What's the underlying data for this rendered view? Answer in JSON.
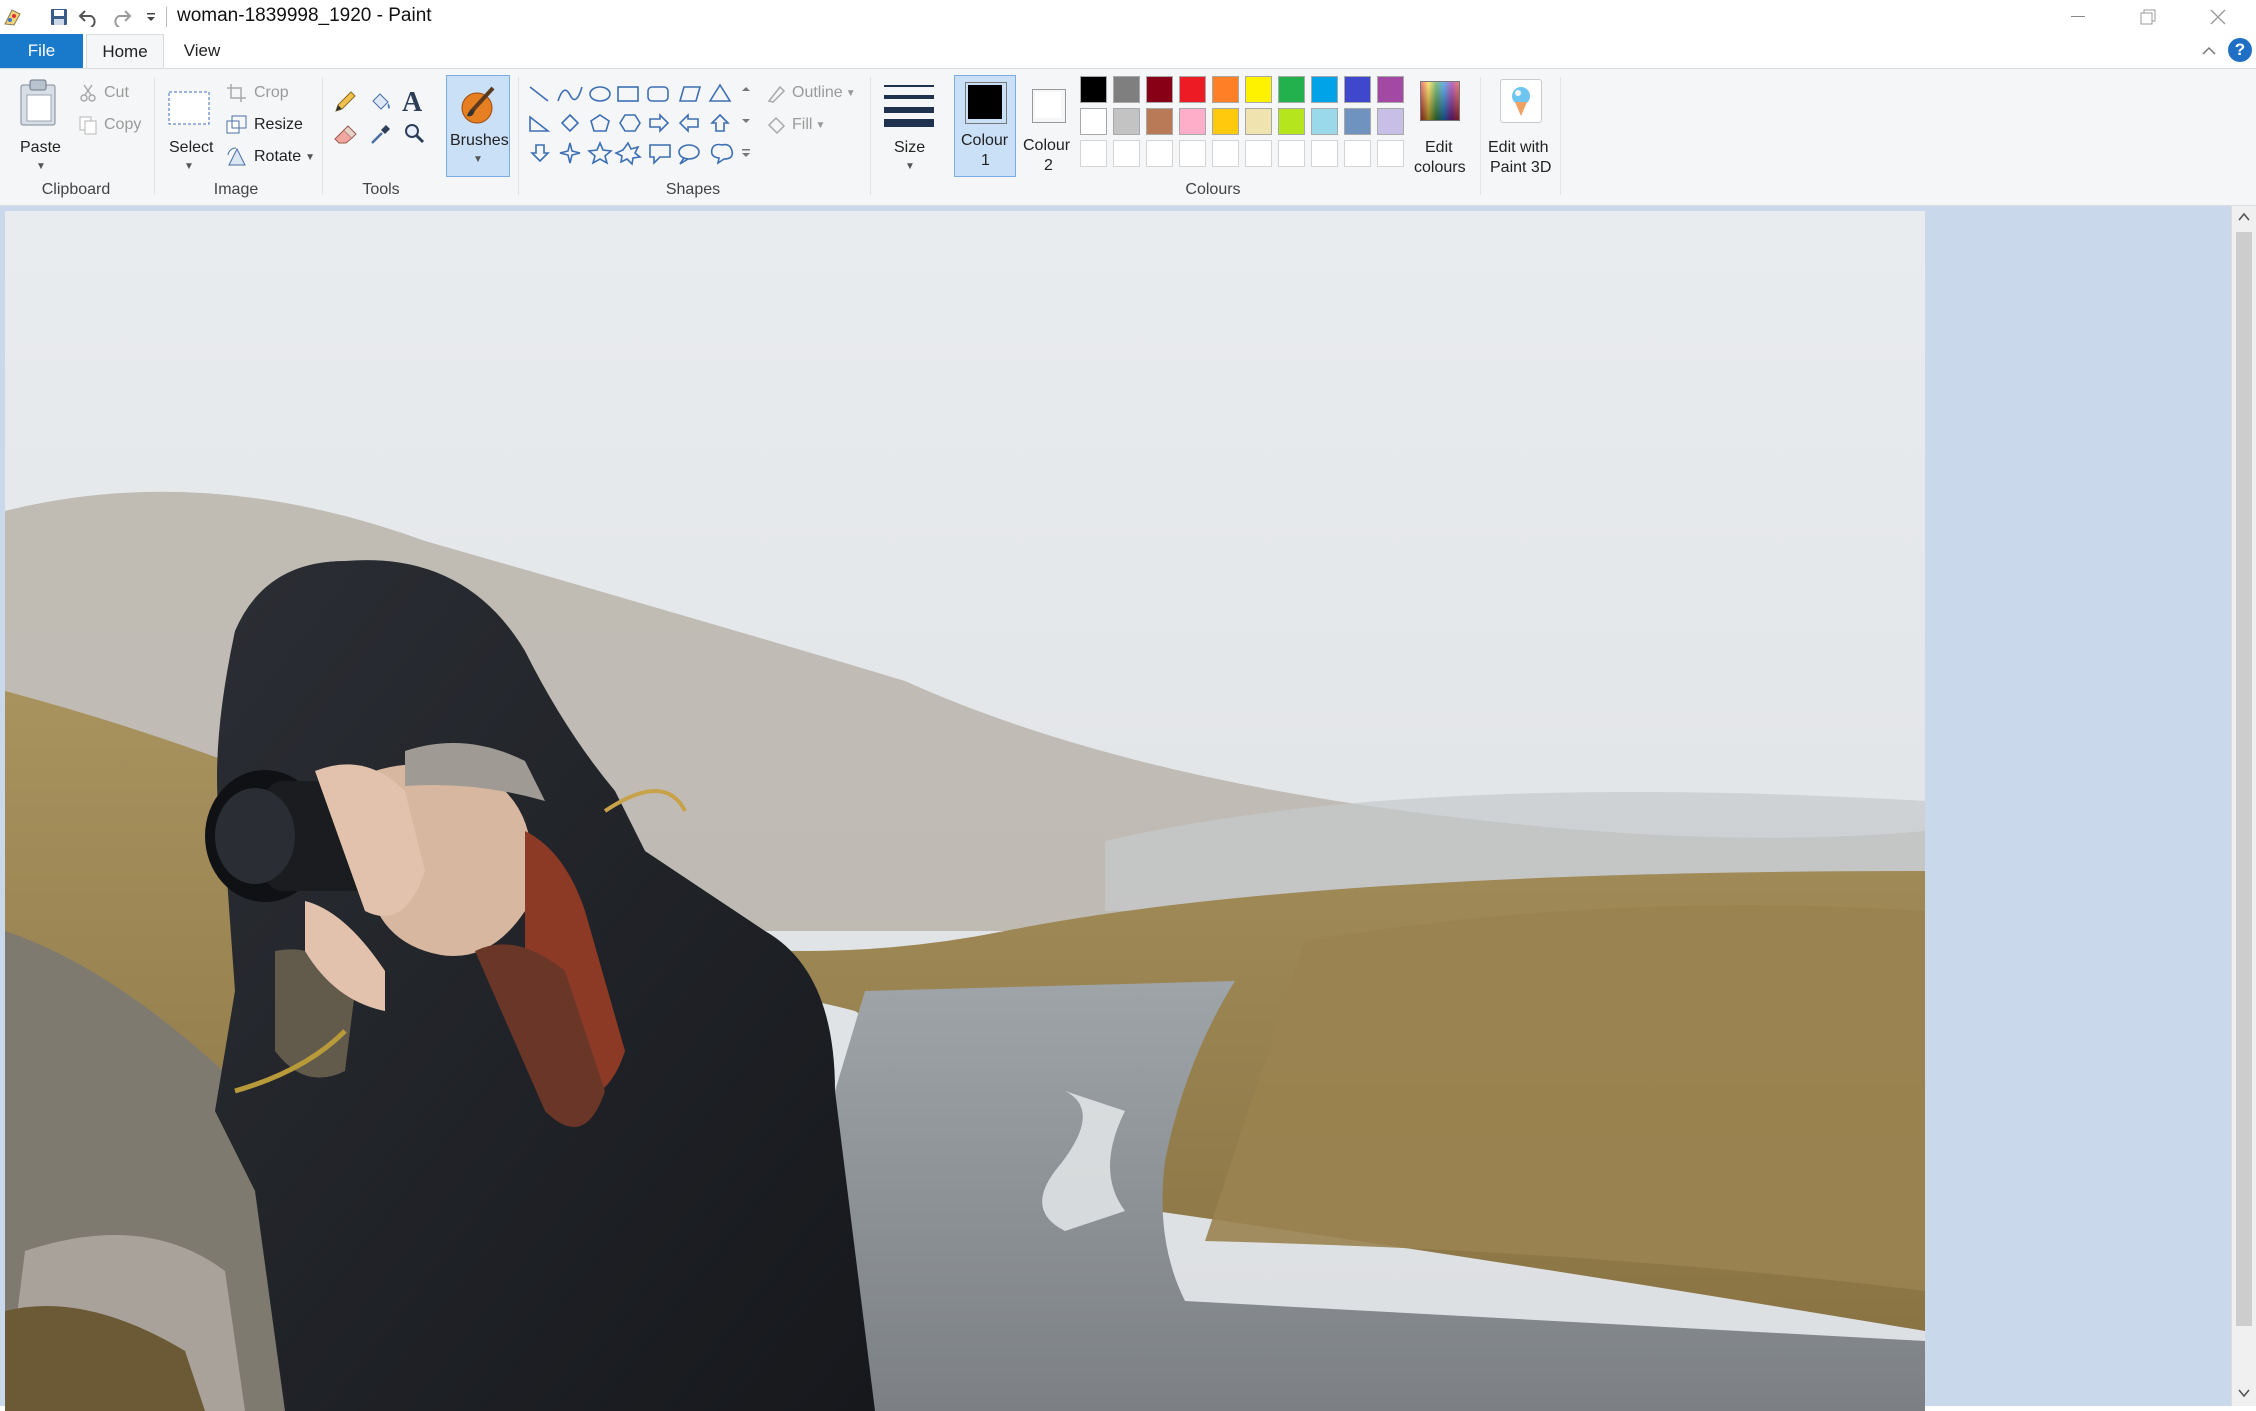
{
  "window": {
    "title": "woman-1839998_1920 - Paint"
  },
  "tabs": {
    "file": "File",
    "home": "Home",
    "view": "View"
  },
  "clipboard": {
    "paste": "Paste",
    "cut": "Cut",
    "copy": "Copy",
    "group": "Clipboard"
  },
  "image": {
    "select": "Select",
    "crop": "Crop",
    "resize": "Resize",
    "rotate": "Rotate",
    "group": "Image"
  },
  "tools": {
    "group": "Tools",
    "brushes": "Brushes"
  },
  "shapes": {
    "outline": "Outline",
    "fill": "Fill",
    "group": "Shapes"
  },
  "size": {
    "label": "Size"
  },
  "colours": {
    "colour1_line1": "Colour",
    "colour1_line2": "1",
    "colour2_line1": "Colour",
    "colour2_line2": "2",
    "edit_line1": "Edit",
    "edit_line2": "colours",
    "group": "Colours",
    "colour1_value": "#000000",
    "colour2_value": "#ffffff",
    "palette_row1": [
      "#000000",
      "#7f7f7f",
      "#880015",
      "#ed1c24",
      "#ff7f27",
      "#fff200",
      "#22b14c",
      "#00a2e8",
      "#3f48cc",
      "#a349a4"
    ],
    "palette_row2": [
      "#ffffff",
      "#c3c3c3",
      "#b97a57",
      "#ffaec9",
      "#ffc90e",
      "#efe4b0",
      "#b5e61d",
      "#99d9ea",
      "#7092be",
      "#c8bfe7"
    ]
  },
  "paint3d": {
    "line1": "Edit with",
    "line2": "Paint 3D"
  }
}
